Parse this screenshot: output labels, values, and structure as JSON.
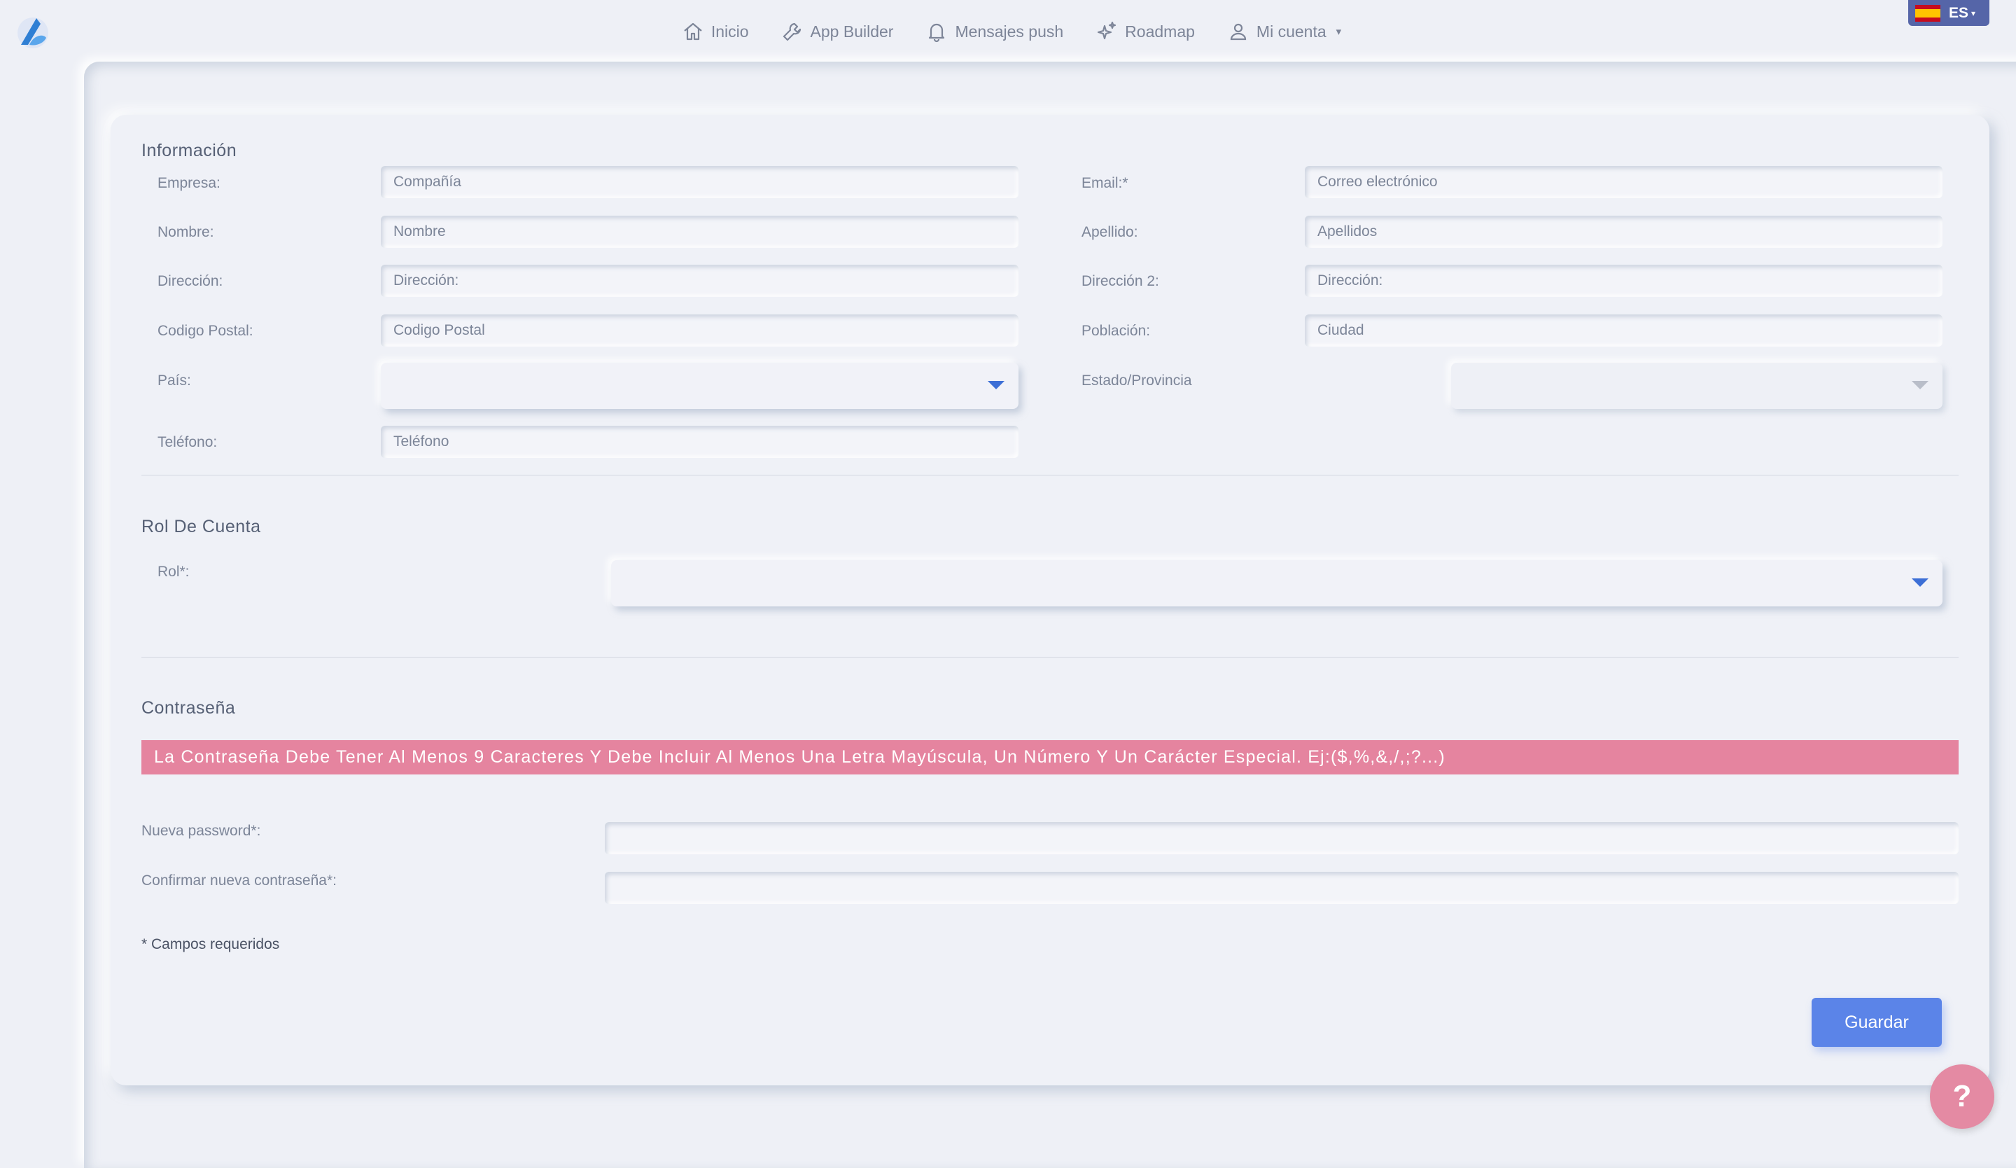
{
  "nav": {
    "items": [
      {
        "label": "Inicio",
        "icon": "home-icon"
      },
      {
        "label": "App Builder",
        "icon": "wrench-icon"
      },
      {
        "label": "Mensajes push",
        "icon": "bell-icon"
      },
      {
        "label": "Roadmap",
        "icon": "sparkle-icon"
      },
      {
        "label": "Mi cuenta",
        "icon": "user-icon"
      }
    ],
    "language": "ES"
  },
  "info": {
    "title": "Información",
    "company_label": "Empresa:",
    "company_placeholder": "Compañía",
    "email_label": "Email:*",
    "email_placeholder": "Correo electrónico",
    "name_label": "Nombre:",
    "name_placeholder": "Nombre",
    "lastname_label": "Apellido:",
    "lastname_placeholder": "Apellidos",
    "address_label": "Dirección:",
    "address_placeholder": "Dirección:",
    "address2_label": "Dirección 2:",
    "address2_placeholder": "Dirección:",
    "zip_label": "Codigo Postal:",
    "zip_placeholder": "Codigo Postal",
    "city_label": "Población:",
    "city_placeholder": "Ciudad",
    "country_label": "País:",
    "state_label": "Estado/Provincia",
    "phone_label": "Teléfono:",
    "phone_placeholder": "Teléfono"
  },
  "role": {
    "title": "Rol De Cuenta",
    "role_label": "Rol*:"
  },
  "password": {
    "title": "Contraseña",
    "alert": "La Contraseña Debe Tener Al Menos 9 Caracteres Y Debe Incluir Al Menos Una Letra Mayúscula, Un Número Y Un Carácter Especial. Ej:($,%,&,/,;?...)",
    "new_label": "Nueva password*:",
    "confirm_label": "Confirmar nueva contraseña*:"
  },
  "required_note": "* Campos requeridos",
  "save_label": "Guardar",
  "help_label": "?",
  "colors": {
    "background": "#eef0f6",
    "accent": "#5b84e8",
    "alert": "#e5849f",
    "help": "#e48aa3",
    "lang_badge": "#5565a8"
  }
}
